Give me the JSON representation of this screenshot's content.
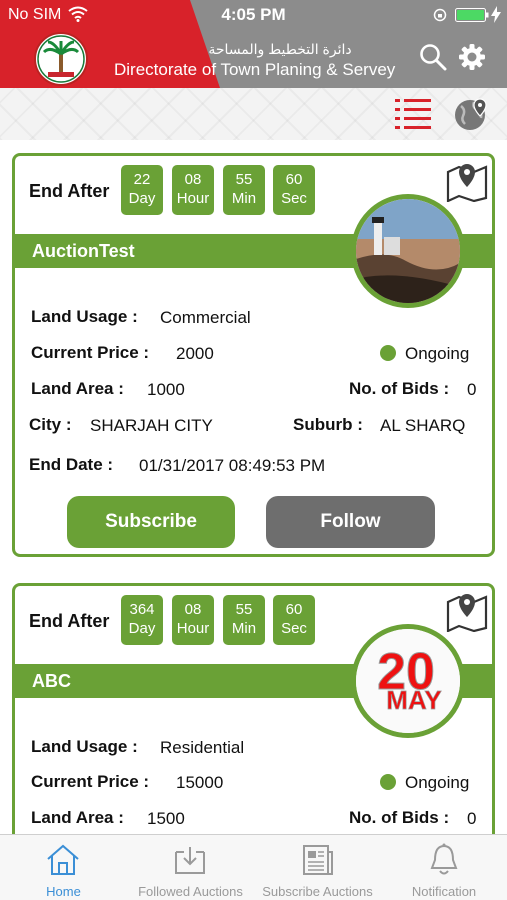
{
  "status_bar": {
    "carrier": "No SIM",
    "time": "4:05 PM"
  },
  "header": {
    "title_ar": "دائرة التخطيط والمساحة",
    "title_en": "Directorate of Town Planing & Servey"
  },
  "colors": {
    "brand_green": "#6aa136",
    "brand_red": "#d8222a",
    "header_gray": "#8c8c8c",
    "tab_active": "#3b8fd6",
    "follow_gray": "#6e6e6e"
  },
  "auctions": [
    {
      "end_after_label": "End After",
      "countdown": [
        {
          "value": "22",
          "unit": "Day"
        },
        {
          "value": "08",
          "unit": "Hour"
        },
        {
          "value": "55",
          "unit": "Min"
        },
        {
          "value": "60",
          "unit": "Sec"
        }
      ],
      "title": "AuctionTest",
      "land_usage_label": "Land Usage :",
      "land_usage": "Commercial",
      "current_price_label": "Current Price :",
      "current_price": "2000",
      "status": "Ongoing",
      "land_area_label": "Land Area :",
      "land_area": "1000",
      "bids_label": "No. of Bids :",
      "bids": "0",
      "city_label": "City :",
      "city": "SHARJAH CITY",
      "suburb_label": "Suburb :",
      "suburb": "AL SHARQ",
      "end_date_label": "End Date :",
      "end_date": "01/31/2017 08:49:53 PM",
      "subscribe_label": "Subscribe",
      "follow_label": "Follow"
    },
    {
      "end_after_label": "End After",
      "countdown": [
        {
          "value": "364",
          "unit": "Day"
        },
        {
          "value": "08",
          "unit": "Hour"
        },
        {
          "value": "55",
          "unit": "Min"
        },
        {
          "value": "60",
          "unit": "Sec"
        }
      ],
      "title": "ABC",
      "thumb_text": "20",
      "thumb_subtext": "MAY",
      "land_usage_label": "Land Usage :",
      "land_usage": "Residential",
      "current_price_label": "Current Price :",
      "current_price": "15000",
      "status": "Ongoing",
      "land_area_label": "Land Area :",
      "land_area": "1500",
      "bids_label": "No. of Bids :",
      "bids": "0"
    }
  ],
  "tab_bar": [
    {
      "label": "Home",
      "icon": "home-icon",
      "active": true
    },
    {
      "label": "Followed Auctions",
      "icon": "followed-icon",
      "active": false
    },
    {
      "label": "Subscribe Auctions",
      "icon": "newspaper-icon",
      "active": false
    },
    {
      "label": "Notification",
      "icon": "bell-icon",
      "active": false
    }
  ]
}
